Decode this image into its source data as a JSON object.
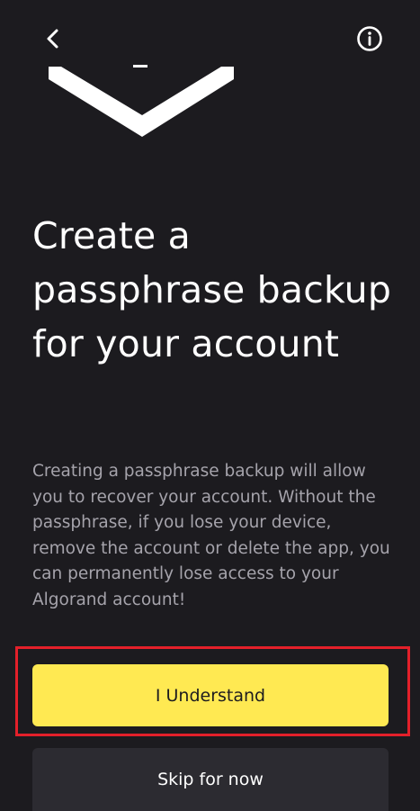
{
  "header": {
    "back_icon": "chevron-left-icon",
    "info_icon": "info-circle-icon"
  },
  "main": {
    "title": "Create a passphrase backup for your account",
    "description": "Creating a passphrase backup will allow you to recover your account. Without the passphrase, if you lose your device, remove the account or delete the app, you can permanently lose access to your Algorand account!"
  },
  "actions": {
    "primary_label": "I Understand",
    "secondary_label": "Skip for now"
  },
  "colors": {
    "background": "#1c1b1f",
    "primary_button": "#ffe952",
    "secondary_button": "#2c2b31",
    "highlight_border": "#e3202a",
    "description_text": "#a5a3ab"
  }
}
